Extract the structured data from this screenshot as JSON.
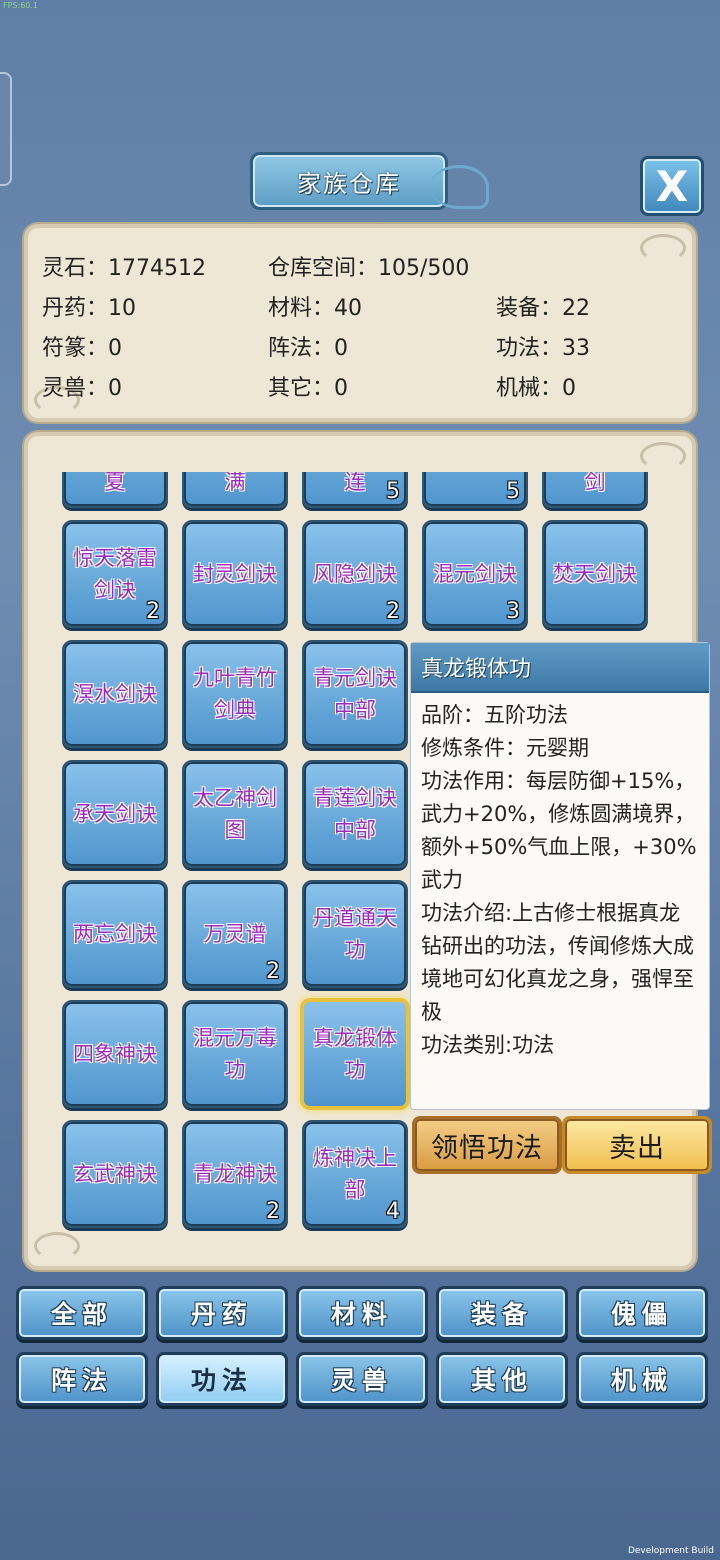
{
  "debug": {
    "fps": "FPS:60.1",
    "build": "Development Build"
  },
  "header": {
    "title": "家族仓库",
    "close_label": "X"
  },
  "stats": {
    "lingshi": "灵石：1774512",
    "space": "仓库空间：105/500",
    "danyao": "丹药：10",
    "cailiao": "材料：40",
    "zhuangbei": "装备：22",
    "fuzhuan": "符篆：0",
    "zhenfa": "阵法：0",
    "gongfa": "功法：33",
    "lingshou": "灵兽：0",
    "qita": "其它：0",
    "jixie": "机械：0"
  },
  "items": [
    {
      "name": "夏",
      "count": ""
    },
    {
      "name": "满",
      "count": ""
    },
    {
      "name": "连",
      "count": "5"
    },
    {
      "name": "",
      "count": "5"
    },
    {
      "name": "剑",
      "count": ""
    },
    {
      "name": "惊天落雷剑诀",
      "count": "2"
    },
    {
      "name": "封灵剑诀",
      "count": ""
    },
    {
      "name": "风隐剑诀",
      "count": "2"
    },
    {
      "name": "混元剑诀",
      "count": "3"
    },
    {
      "name": "焚天剑诀",
      "count": ""
    },
    {
      "name": "溟水剑诀",
      "count": ""
    },
    {
      "name": "九叶青竹剑典",
      "count": ""
    },
    {
      "name": "青元剑诀中部",
      "count": ""
    },
    {
      "name": "承天剑诀",
      "count": ""
    },
    {
      "name": "太乙神剑图",
      "count": ""
    },
    {
      "name": "青莲剑诀中部",
      "count": ""
    },
    {
      "name": "两忘剑诀",
      "count": ""
    },
    {
      "name": "万灵谱",
      "count": "2"
    },
    {
      "name": "丹道通天功",
      "count": ""
    },
    {
      "name": "四象神诀",
      "count": ""
    },
    {
      "name": "混元万毒功",
      "count": ""
    },
    {
      "name": "真龙锻体功",
      "count": ""
    },
    {
      "name": "玄武神诀",
      "count": ""
    },
    {
      "name": "青龙神诀",
      "count": "2"
    },
    {
      "name": "炼神决上部",
      "count": "4"
    }
  ],
  "tooltip": {
    "title": "真龙锻体功",
    "grade": "品阶：五阶功法",
    "condition": "修炼条件：元婴期",
    "effect": "功法作用：每层防御+15%，武力+20%，修炼圆满境界，额外+50%气血上限，+30%武力",
    "intro": "功法介绍:上古修士根据真龙钻研出的功法，传闻修炼大成境地可幻化真龙之身，强悍至极",
    "category": "功法类别:功法"
  },
  "actions": {
    "learn": "领悟功法",
    "sell": "卖出"
  },
  "tabs": [
    "全部",
    "丹药",
    "材料",
    "装备",
    "傀儡",
    "阵法",
    "功法",
    "灵兽",
    "其他",
    "机械"
  ],
  "active_tab": "功法",
  "selected_item": "真龙锻体功"
}
